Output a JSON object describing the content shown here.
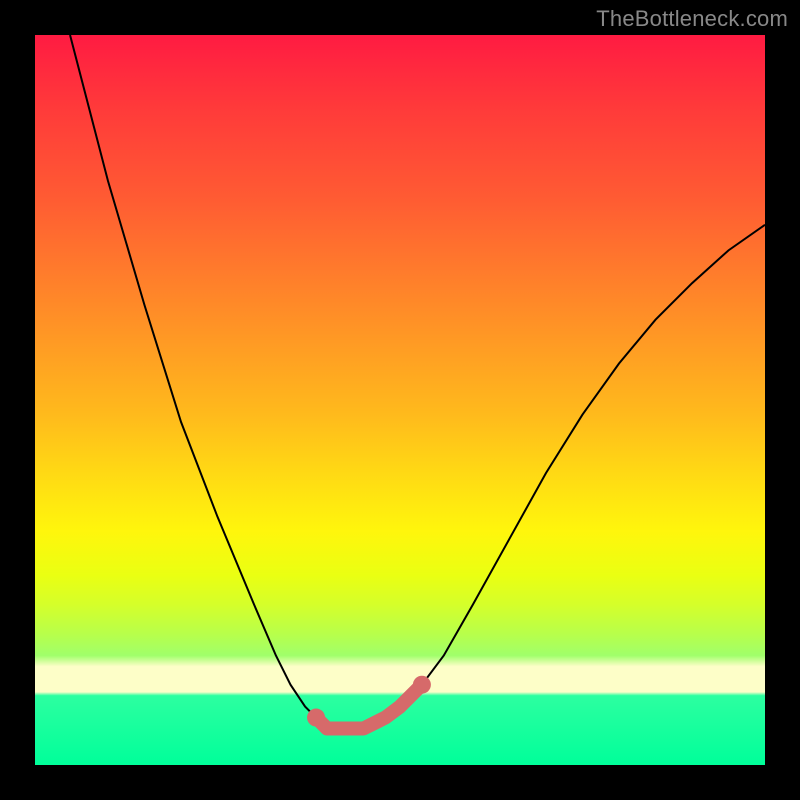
{
  "watermark": "TheBottleneck.com",
  "chart_data": {
    "type": "line",
    "title": "",
    "xlabel": "",
    "ylabel": "",
    "xlim": [
      0,
      100
    ],
    "ylim": [
      0,
      100
    ],
    "series": [
      {
        "name": "curve",
        "x": [
          4.8,
          10,
          15,
          20,
          25,
          30,
          33,
          35,
          37,
          38.5,
          40,
          45,
          48,
          50,
          53,
          56,
          60,
          65,
          70,
          75,
          80,
          85,
          90,
          95,
          100
        ],
        "values": [
          100,
          80,
          63,
          47,
          34,
          22,
          15,
          11,
          8,
          6.5,
          5,
          5,
          6.5,
          8,
          11,
          15,
          22,
          31,
          40,
          48,
          55,
          61,
          66,
          70.5,
          74
        ]
      },
      {
        "name": "trough-highlight",
        "x": [
          38.5,
          40,
          45,
          48,
          50,
          53
        ],
        "values": [
          6.5,
          5,
          5,
          6.5,
          8,
          11
        ]
      }
    ],
    "colors": {
      "curve": "#000000",
      "highlight": "#d66a6a"
    }
  }
}
